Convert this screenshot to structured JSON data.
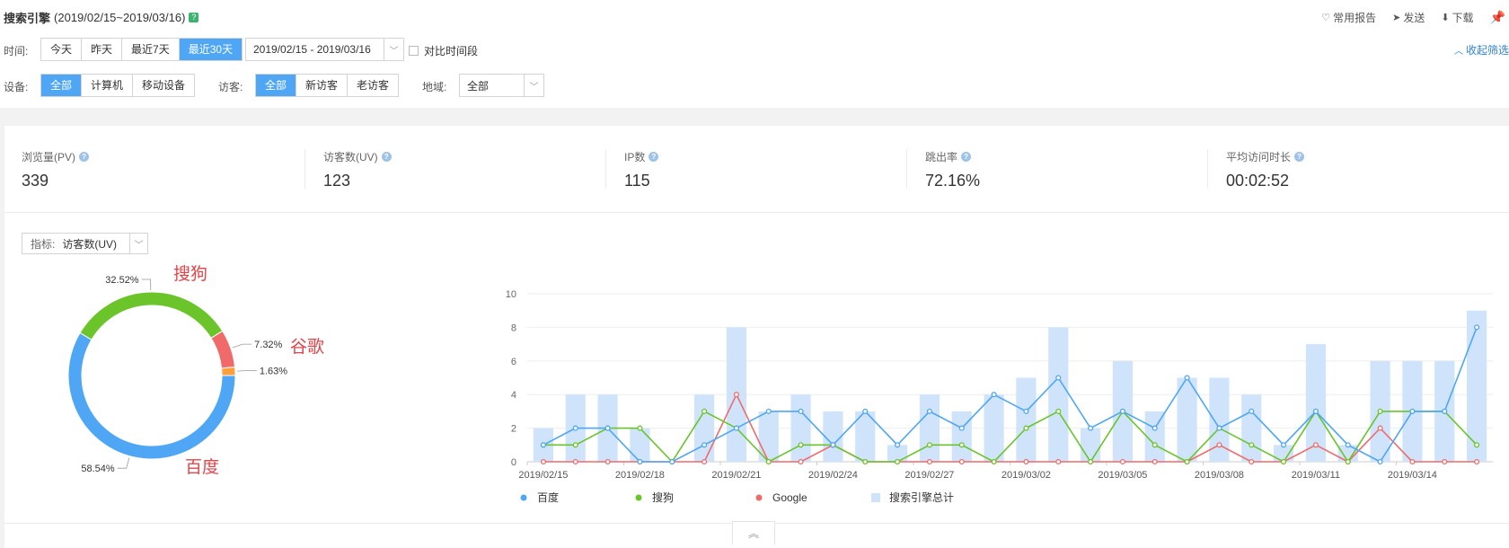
{
  "header": {
    "title": "搜索引擎",
    "date_range": "(2019/02/15~2019/03/16)",
    "help_mark": "?",
    "actions": [
      {
        "icon": "heart-icon",
        "glyph": "♡",
        "label": "常用报告"
      },
      {
        "icon": "send-icon",
        "glyph": "➤",
        "label": "发送"
      },
      {
        "icon": "download-icon",
        "glyph": "⬇",
        "label": "下载"
      }
    ]
  },
  "filters": {
    "time_label": "时间:",
    "time_buttons": [
      "今天",
      "昨天",
      "最近7天",
      "最近30天"
    ],
    "time_active": 3,
    "date_select": "2019/02/15 - 2019/03/16",
    "compare_label": "对比时间段",
    "collapse_label": "收起筛选",
    "device_label": "设备:",
    "device_buttons": [
      "全部",
      "计算机",
      "移动设备"
    ],
    "device_active": 0,
    "visitor_label": "访客:",
    "visitor_buttons": [
      "全部",
      "新访客",
      "老访客"
    ],
    "visitor_active": 0,
    "region_label": "地域:",
    "region_select": "全部"
  },
  "metrics": [
    {
      "label": "浏览量(PV)",
      "value": "339"
    },
    {
      "label": "访客数(UV)",
      "value": "123"
    },
    {
      "label": "IP数",
      "value": "115"
    },
    {
      "label": "跳出率",
      "value": "72.16%"
    },
    {
      "label": "平均访问时长",
      "value": "00:02:52"
    }
  ],
  "indicator": {
    "key": "指标:",
    "value": "访客数(UV)"
  },
  "colors": {
    "baidu": "#4ea6f4",
    "sogou": "#6ac42a",
    "google": "#f06a6a",
    "other": "#ff9f3a",
    "bar": "#cfe4fb",
    "annotation": "#e0454a"
  },
  "chart_data": [
    {
      "type": "pie",
      "title": "",
      "slices": [
        {
          "name": "百度",
          "value": 58.54,
          "label": "58.54%"
        },
        {
          "name": "搜狗",
          "value": 32.52,
          "label": "32.52%"
        },
        {
          "name": "谷歌",
          "value": 7.32,
          "label": "7.32%"
        },
        {
          "name": "",
          "value": 1.63,
          "label": "1.63%"
        }
      ],
      "annotations": [
        "搜狗",
        "谷歌",
        "百度"
      ]
    },
    {
      "type": "line",
      "title": "",
      "xlabel": "",
      "ylabel": "",
      "ylim": [
        0,
        10
      ],
      "yticks": [
        0,
        2,
        4,
        6,
        8,
        10
      ],
      "x": [
        "2019/02/15",
        "2019/02/16",
        "2019/02/17",
        "2019/02/18",
        "2019/02/19",
        "2019/02/20",
        "2019/02/21",
        "2019/02/22",
        "2019/02/23",
        "2019/02/24",
        "2019/02/25",
        "2019/02/26",
        "2019/02/27",
        "2019/02/28",
        "2019/03/01",
        "2019/03/02",
        "2019/03/03",
        "2019/03/04",
        "2019/03/05",
        "2019/03/06",
        "2019/03/07",
        "2019/03/08",
        "2019/03/09",
        "2019/03/10",
        "2019/03/11",
        "2019/03/12",
        "2019/03/13",
        "2019/03/14",
        "2019/03/15",
        "2019/03/16"
      ],
      "xtick_labels": [
        "2019/02/15",
        "2019/02/18",
        "2019/02/21",
        "2019/02/24",
        "2019/02/27",
        "2019/03/02",
        "2019/03/05",
        "2019/03/08",
        "2019/03/11",
        "2019/03/14"
      ],
      "grid": true,
      "legend_position": "bottom-left",
      "series": [
        {
          "name": "百度",
          "type": "line",
          "values": [
            1,
            2,
            2,
            0,
            0,
            1,
            2,
            3,
            3,
            1,
            3,
            1,
            3,
            2,
            4,
            3,
            5,
            2,
            3,
            2,
            5,
            2,
            3,
            1,
            3,
            1,
            0,
            3,
            3,
            8
          ]
        },
        {
          "name": "搜狗",
          "type": "line",
          "values": [
            1,
            1,
            2,
            2,
            0,
            3,
            2,
            0,
            1,
            1,
            0,
            0,
            1,
            1,
            0,
            2,
            3,
            0,
            3,
            1,
            0,
            2,
            1,
            0,
            3,
            0,
            3,
            3,
            3,
            1
          ]
        },
        {
          "name": "Google",
          "type": "line",
          "values": [
            0,
            0,
            0,
            0,
            0,
            0,
            4,
            0,
            0,
            1,
            0,
            0,
            0,
            0,
            0,
            0,
            0,
            0,
            0,
            0,
            0,
            1,
            0,
            0,
            1,
            0,
            2,
            0,
            0,
            0
          ]
        },
        {
          "name": "搜索引擎总计",
          "type": "bar",
          "values": [
            2,
            4,
            4,
            2,
            0,
            4,
            8,
            3,
            4,
            3,
            3,
            1,
            4,
            3,
            4,
            5,
            8,
            2,
            6,
            3,
            5,
            5,
            4,
            1,
            7,
            1,
            6,
            6,
            6,
            9
          ]
        }
      ]
    }
  ]
}
